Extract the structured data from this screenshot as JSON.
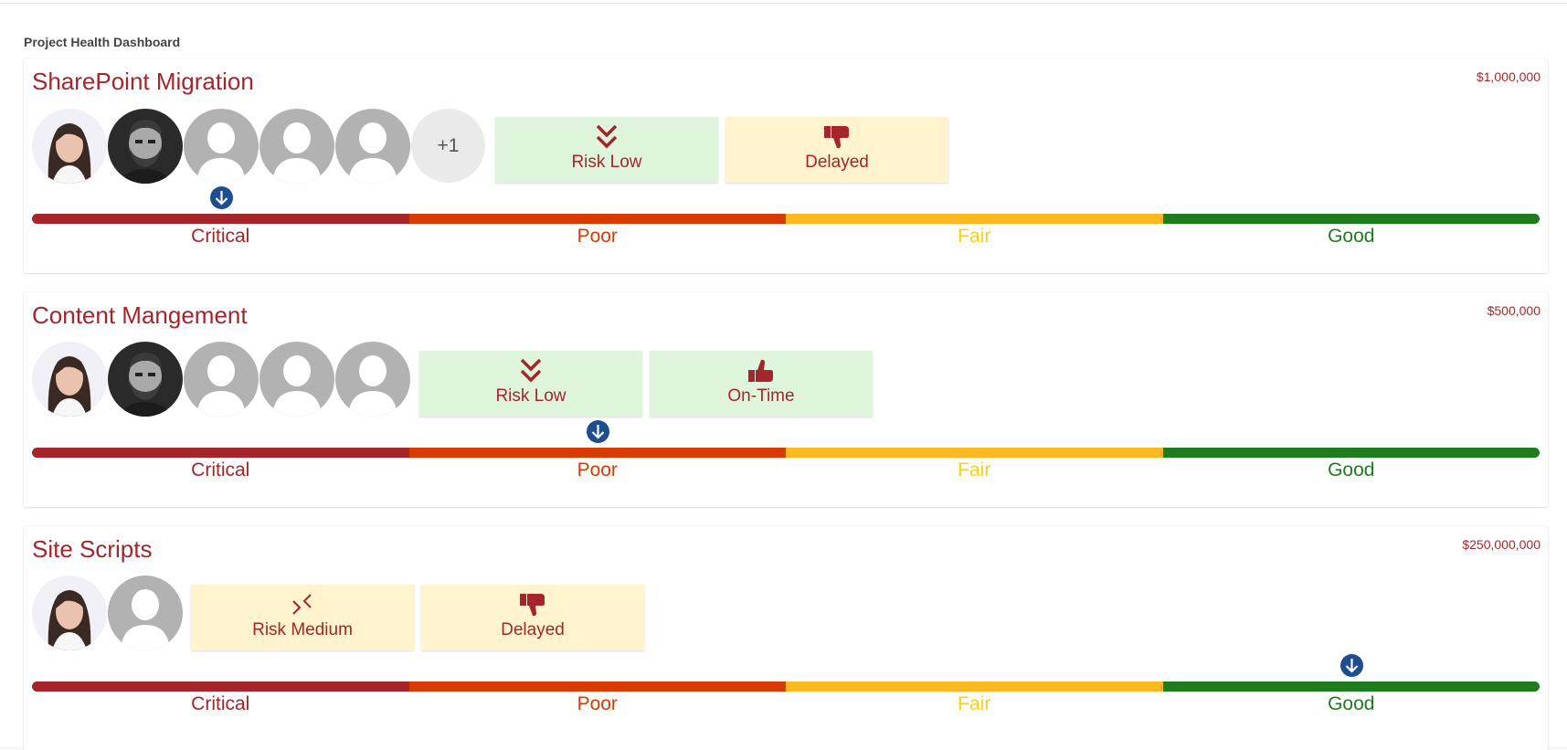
{
  "dashboard": {
    "title": "Project Health Dashboard"
  },
  "health_scale": [
    "Critical",
    "Poor",
    "Fair",
    "Good"
  ],
  "colors": {
    "critical": "#a4262c",
    "poor": "#d83b01",
    "fair": "#fbb81f",
    "good": "#1e7b1e",
    "marker": "#1f4e8f"
  },
  "projects": [
    {
      "name": "SharePoint Migration",
      "budget": "$1,000,000",
      "team": [
        "photo-woman",
        "photo-man",
        "placeholder",
        "placeholder",
        "placeholder"
      ],
      "overflow": "+1",
      "risk": {
        "label": "Risk Low",
        "icon": "double-chevron-down-icon"
      },
      "schedule": {
        "label": "Delayed",
        "icon": "thumbs-down-icon"
      },
      "health": "Critical"
    },
    {
      "name": "Content Mangement",
      "budget": "$500,000",
      "team": [
        "photo-woman",
        "photo-man",
        "placeholder",
        "placeholder",
        "placeholder"
      ],
      "risk": {
        "label": "Risk Low",
        "icon": "double-chevron-down-icon"
      },
      "schedule": {
        "label": "On-Time",
        "icon": "thumbs-up-icon"
      },
      "health": "Poor"
    },
    {
      "name": "Site Scripts",
      "budget": "$250,000,000",
      "team": [
        "photo-woman",
        "placeholder"
      ],
      "risk": {
        "label": "Risk Medium",
        "icon": "risk-medium-icon"
      },
      "schedule": {
        "label": "Delayed",
        "icon": "thumbs-down-icon"
      },
      "health": "Good"
    }
  ]
}
